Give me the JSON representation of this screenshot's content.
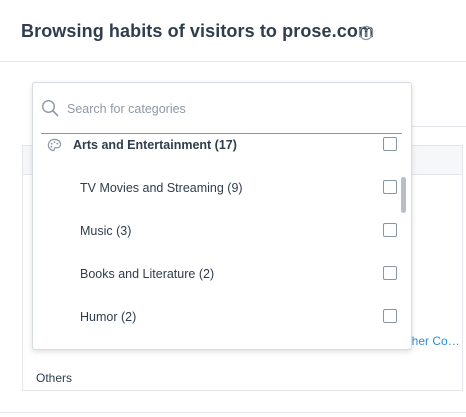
{
  "header": {
    "title": "Browsing habits of visitors to prose.com",
    "info_icon": "info-circle-icon"
  },
  "background": {
    "link_text": "Other Computer Software",
    "others_label": "Others"
  },
  "dropdown": {
    "search": {
      "placeholder": "Search for categories",
      "value": "",
      "icon": "search-icon"
    },
    "items": [
      {
        "label": "Arts and Entertainment (17)",
        "level": "parent",
        "icon": "palette-icon",
        "checked": false
      },
      {
        "label": "TV Movies and Streaming (9)",
        "level": "child",
        "checked": false
      },
      {
        "label": "Music (3)",
        "level": "child",
        "checked": false
      },
      {
        "label": "Books and Literature (2)",
        "level": "child",
        "checked": false
      },
      {
        "label": "Humor (2)",
        "level": "child",
        "checked": false
      }
    ]
  },
  "colors": {
    "title": "#2f3d4c",
    "link": "#2d8fd5",
    "border": "#d6dbe1"
  }
}
